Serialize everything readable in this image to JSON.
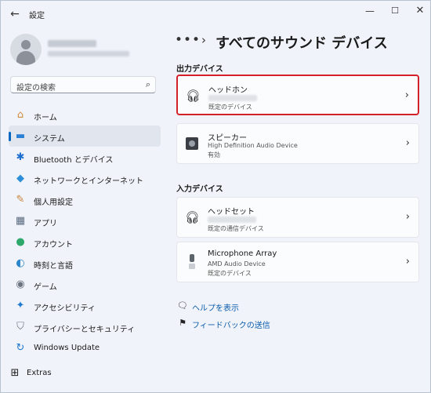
{
  "window": {
    "title": "設定",
    "back_glyph": "←",
    "minimize_glyph": "—",
    "maximize_glyph": "☐",
    "close_glyph": "✕"
  },
  "search": {
    "placeholder": "設定の検索",
    "icon": "search-icon"
  },
  "sidebar": {
    "items": [
      {
        "label": "ホーム",
        "icon": "home-icon",
        "glyph": "⌂",
        "color": "#d28b3a",
        "active": false
      },
      {
        "label": "システム",
        "icon": "monitor-icon",
        "glyph": "▬",
        "color": "#2b7fd4",
        "active": true
      },
      {
        "label": "Bluetooth とデバイス",
        "icon": "bluetooth-icon",
        "glyph": "✱",
        "color": "#1f6fd0",
        "active": false
      },
      {
        "label": "ネットワークとインターネット",
        "icon": "wifi-icon",
        "glyph": "◆",
        "color": "#2d8fd8",
        "active": false
      },
      {
        "label": "個人用設定",
        "icon": "brush-icon",
        "glyph": "✎",
        "color": "#c9843c",
        "active": false
      },
      {
        "label": "アプリ",
        "icon": "apps-icon",
        "glyph": "▦",
        "color": "#5a6b80",
        "active": false
      },
      {
        "label": "アカウント",
        "icon": "account-icon",
        "glyph": "●",
        "color": "#2ea86a",
        "active": false
      },
      {
        "label": "時刻と言語",
        "icon": "globe-clock-icon",
        "glyph": "◐",
        "color": "#2a86c8",
        "active": false
      },
      {
        "label": "ゲーム",
        "icon": "gamepad-icon",
        "glyph": "◉",
        "color": "#6b7280",
        "active": false
      },
      {
        "label": "アクセシビリティ",
        "icon": "accessibility-icon",
        "glyph": "✦",
        "color": "#1f7ad0",
        "active": false
      },
      {
        "label": "プライバシーとセキュリティ",
        "icon": "shield-icon",
        "glyph": "⛉",
        "color": "#6b7480",
        "active": false
      },
      {
        "label": "Windows Update",
        "icon": "windows-update-icon",
        "glyph": "↻",
        "color": "#1f7ad0",
        "active": false
      }
    ],
    "extras_label": "Extras",
    "extras_icon": "extras-icon",
    "extras_glyph": "⊞"
  },
  "breadcrumb": {
    "dots": "•••",
    "separator": "›",
    "title": "すべてのサウンド デバイス"
  },
  "output_section": {
    "label": "出力デバイス",
    "devices": [
      {
        "name": "ヘッドホン",
        "line1": "",
        "line2": "既定のデバイス",
        "icon": "headphones-icon",
        "selected": true
      },
      {
        "name": "スピーカー",
        "line1": "High Definition Audio Device",
        "line2": "有効",
        "icon": "speaker-icon",
        "selected": false
      }
    ]
  },
  "input_section": {
    "label": "入力デバイス",
    "devices": [
      {
        "name": "ヘッドセット",
        "line1": "",
        "line2": "既定の通信デバイス",
        "icon": "headset-icon",
        "selected": false
      },
      {
        "name": "Microphone Array",
        "line1": "AMD Audio Device",
        "line2": "既定のデバイス",
        "icon": "microphone-icon",
        "selected": false
      }
    ]
  },
  "links": {
    "help": {
      "label": "ヘルプを表示",
      "icon": "help-icon"
    },
    "feedback": {
      "label": "フィードバックの送信",
      "icon": "feedback-icon"
    }
  },
  "chevron_glyph": "›",
  "colors": {
    "accent": "#0067c0",
    "highlight_border": "#d4202a",
    "link": "#0b5cad"
  }
}
